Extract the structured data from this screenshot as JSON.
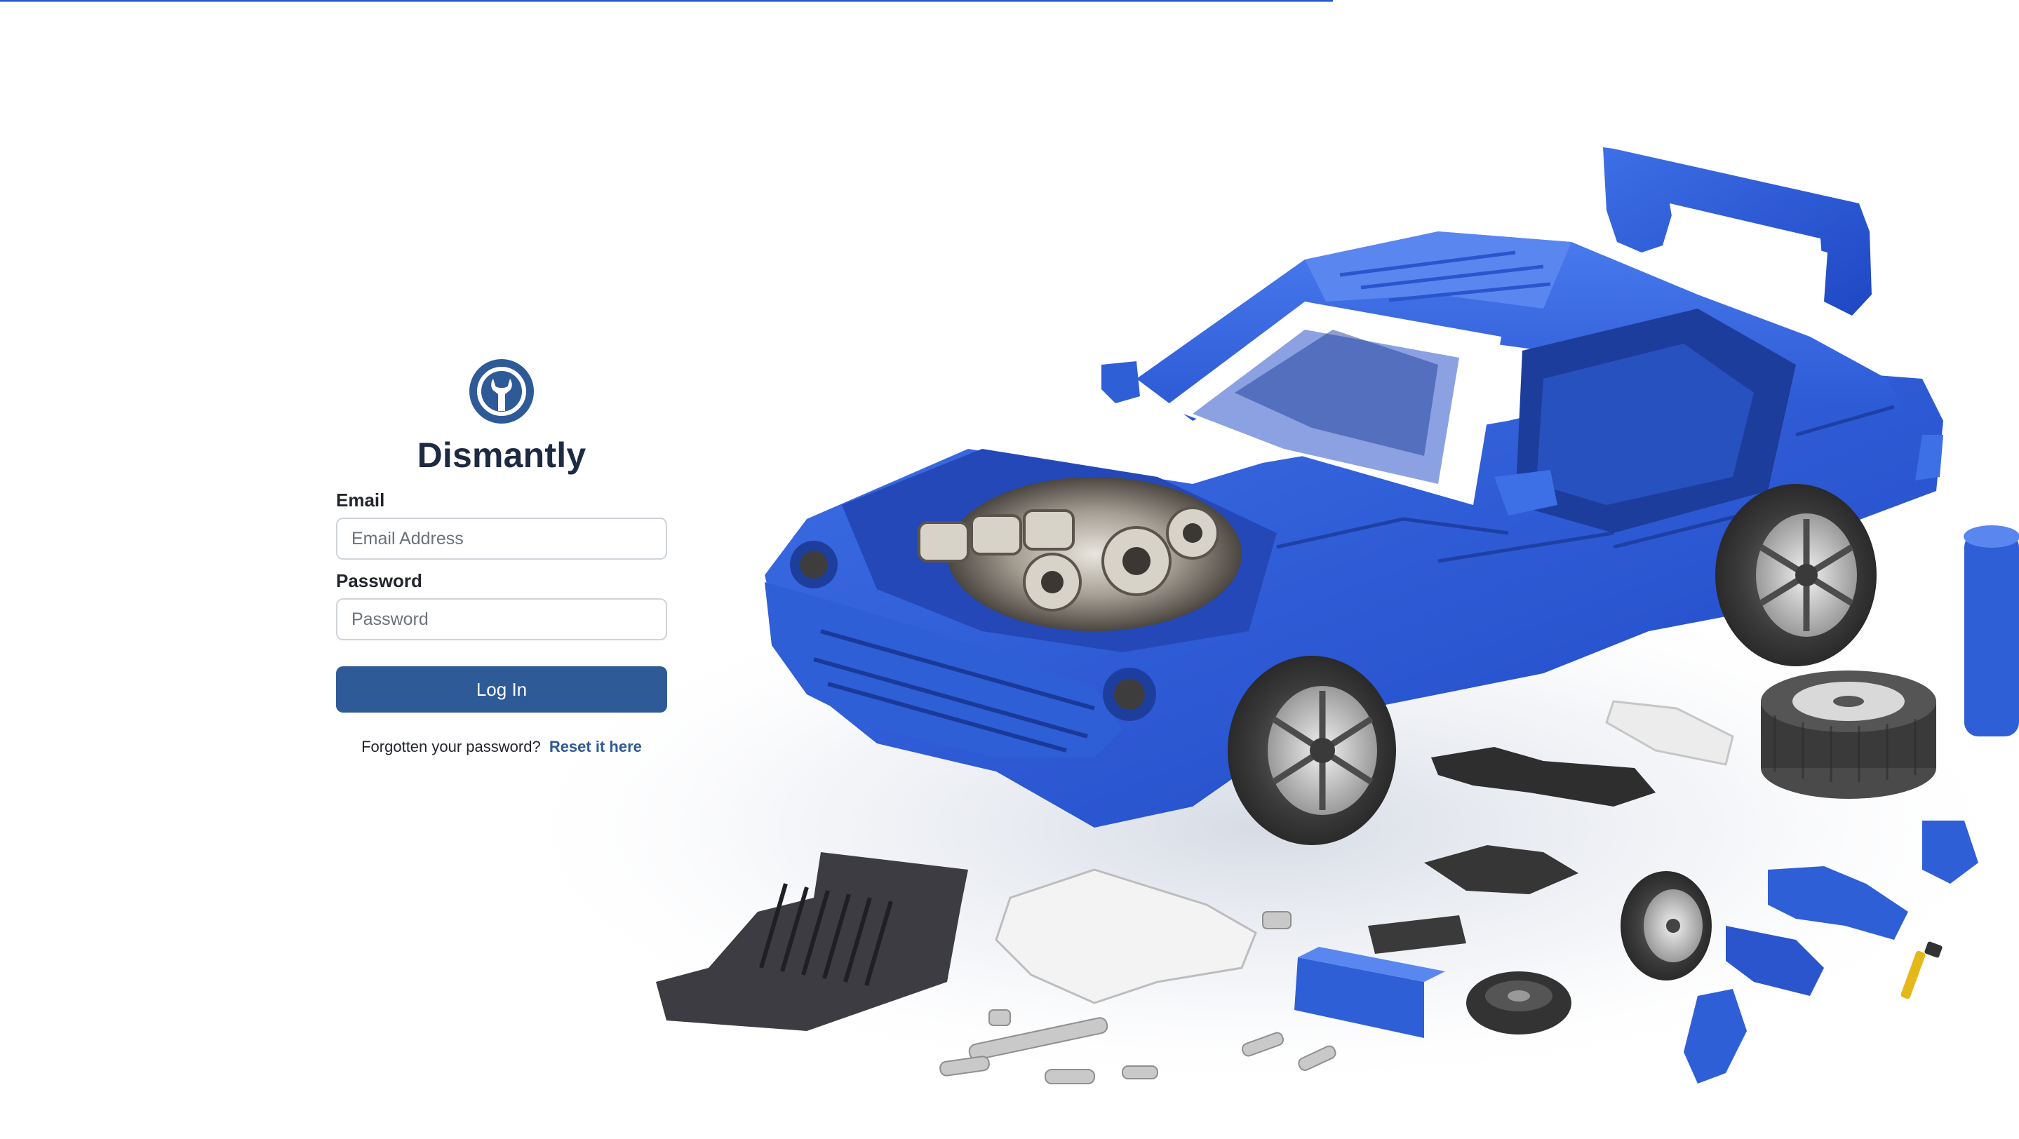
{
  "brand": {
    "name": "Dismantly",
    "logo_icon": "wrench-steering-wheel-icon",
    "color": "#2e5a98"
  },
  "login_form": {
    "email_label": "Email",
    "email_placeholder": "Email Address",
    "email_value": "",
    "password_label": "Password",
    "password_placeholder": "Password",
    "password_value": "",
    "submit_label": "Log In",
    "forgot_text": "Forgotten your password?",
    "reset_link": "Reset it here"
  },
  "hero": {
    "illustration": "dismantled-blue-car-illustration",
    "accent_color": "#2f5fd6"
  }
}
